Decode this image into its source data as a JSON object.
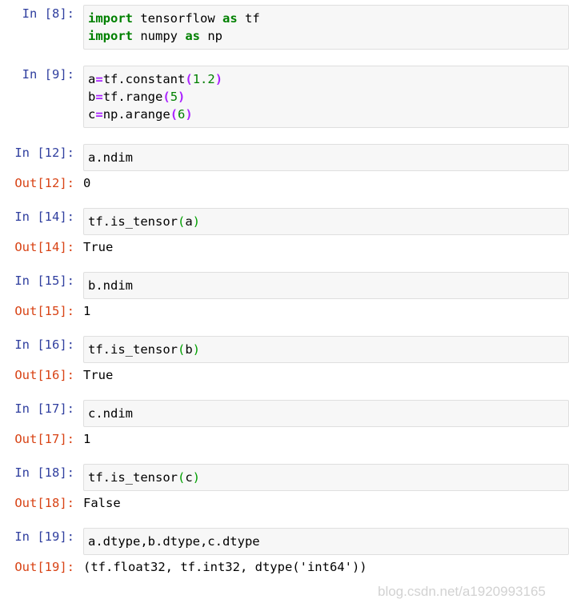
{
  "notebook": {
    "prompt_in_label": "In",
    "prompt_out_label": "Out",
    "cells": [
      {
        "in_prompt": "In [8]:",
        "source_lines": [
          "import tensorflow as tf",
          "import numpy as np"
        ],
        "output": null
      },
      {
        "in_prompt": "In [9]:",
        "source_lines": [
          "a=tf.constant(1.2)",
          "b=tf.range(5)",
          "c=np.arange(6)"
        ],
        "output": null
      },
      {
        "in_prompt": "In [12]:",
        "source_lines": [
          "a.ndim"
        ],
        "out_prompt": "Out[12]:",
        "output": "0"
      },
      {
        "in_prompt": "In [14]:",
        "source_lines": [
          "tf.is_tensor(a)"
        ],
        "out_prompt": "Out[14]:",
        "output": "True"
      },
      {
        "in_prompt": "In [15]:",
        "source_lines": [
          "b.ndim"
        ],
        "out_prompt": "Out[15]:",
        "output": "1"
      },
      {
        "in_prompt": "In [16]:",
        "source_lines": [
          "tf.is_tensor(b)"
        ],
        "out_prompt": "Out[16]:",
        "output": "True"
      },
      {
        "in_prompt": "In [17]:",
        "source_lines": [
          "c.ndim"
        ],
        "out_prompt": "Out[17]:",
        "output": "1"
      },
      {
        "in_prompt": "In [18]:",
        "source_lines": [
          "tf.is_tensor(c)"
        ],
        "out_prompt": "Out[18]:",
        "output": "False"
      },
      {
        "in_prompt": "In [19]:",
        "source_lines": [
          "a.dtype,b.dtype,c.dtype"
        ],
        "out_prompt": "Out[19]:",
        "output": "(tf.float32, tf.int32, dtype('int64'))"
      }
    ],
    "tokens": {
      "c8_kw1": "import",
      "c8_mod1": " tensorflow ",
      "c8_as1": "as",
      "c8_alias1": " tf",
      "c8_kw2": "import",
      "c8_mod2": " numpy ",
      "c8_as2": "as",
      "c8_alias2": " np",
      "c9_l1_a": "a",
      "c9_l1_eq": "=",
      "c9_l1_call": "tf.constant",
      "c9_l1_lp": "(",
      "c9_l1_num": "1.2",
      "c9_l1_rp": ")",
      "c9_l2_a": "b",
      "c9_l2_eq": "=",
      "c9_l2_call": "tf.range",
      "c9_l2_lp": "(",
      "c9_l2_num": "5",
      "c9_l2_rp": ")",
      "c9_l3_a": "c",
      "c9_l3_eq": "=",
      "c9_l3_call": "np.arange",
      "c9_l3_lp": "(",
      "c9_l3_num": "6",
      "c9_l3_rp": ")",
      "istensor_fn": "tf.is_tensor",
      "lparen": "(",
      "rparen": ")",
      "arg_a": "a",
      "arg_b": "b",
      "arg_c": "c",
      "ndim_a": "a.ndim",
      "ndim_b": "b.ndim",
      "ndim_c": "c.ndim",
      "dtype_expr": "a.dtype,b.dtype,c.dtype"
    },
    "colors": {
      "in_prompt": "#303F9F",
      "in_index": "#0000FF",
      "out_prompt": "#D84315",
      "out_index": "#E8330B",
      "keyword": "#008000",
      "number": "#008000",
      "operator": "#AA22FF",
      "call_paren": "#00A000",
      "cell_bg": "#f7f7f7",
      "cell_border": "#dfdfdf",
      "page_bg": "#ffffff",
      "watermark": "#d2d2d2"
    }
  },
  "watermark": {
    "text": "blog.csdn.net/a1920993165"
  }
}
